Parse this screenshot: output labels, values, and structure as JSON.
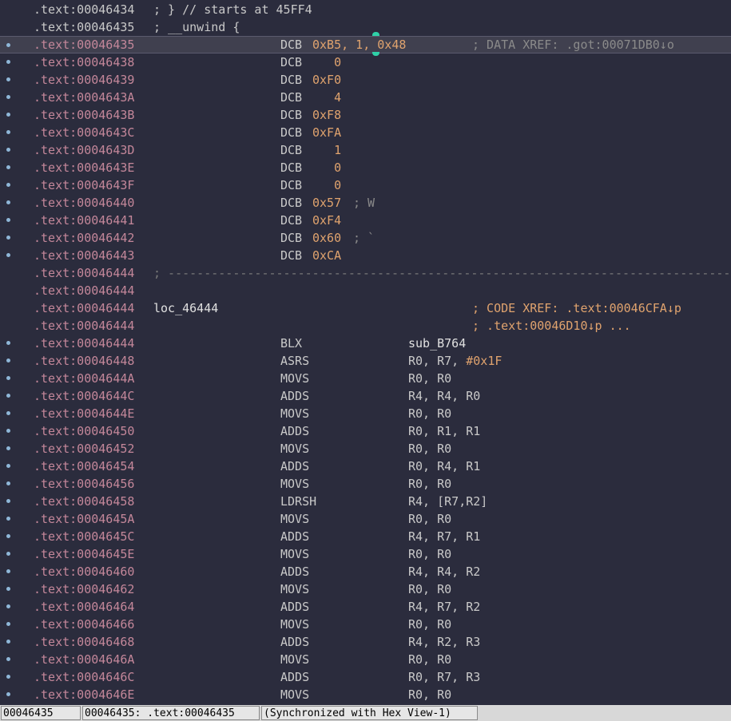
{
  "header_lines": [
    {
      "addr": ".text:00046434",
      "text": "; } // starts at 45FF4"
    },
    {
      "addr": ".text:00046435",
      "text": "; __unwind {"
    }
  ],
  "selected_line": {
    "addr": ".text:00046435",
    "mnemonic": "DCB",
    "value": "0xB5, 1, 0x48",
    "comment": "; DATA XREF: .got:00071DB0↓o"
  },
  "data_lines": [
    {
      "addr": ".text:00046438",
      "mnemonic": "DCB",
      "value": "   0",
      "comment": ""
    },
    {
      "addr": ".text:00046439",
      "mnemonic": "DCB",
      "value": "0xF0",
      "comment": ""
    },
    {
      "addr": ".text:0004643A",
      "mnemonic": "DCB",
      "value": "   4",
      "comment": ""
    },
    {
      "addr": ".text:0004643B",
      "mnemonic": "DCB",
      "value": "0xF8",
      "comment": ""
    },
    {
      "addr": ".text:0004643C",
      "mnemonic": "DCB",
      "value": "0xFA",
      "comment": ""
    },
    {
      "addr": ".text:0004643D",
      "mnemonic": "DCB",
      "value": "   1",
      "comment": ""
    },
    {
      "addr": ".text:0004643E",
      "mnemonic": "DCB",
      "value": "   0",
      "comment": ""
    },
    {
      "addr": ".text:0004643F",
      "mnemonic": "DCB",
      "value": "   0",
      "comment": ""
    },
    {
      "addr": ".text:00046440",
      "mnemonic": "DCB",
      "value": "0x57",
      "comment": "; W"
    },
    {
      "addr": ".text:00046441",
      "mnemonic": "DCB",
      "value": "0xF4",
      "comment": ""
    },
    {
      "addr": ".text:00046442",
      "mnemonic": "DCB",
      "value": "0x60",
      "comment": "; `"
    },
    {
      "addr": ".text:00046443",
      "mnemonic": "DCB",
      "value": "0xCA",
      "comment": ""
    }
  ],
  "separator_line": {
    "addr": ".text:00046444",
    "text": "; ---------------------------------------------------------------------------------------------"
  },
  "empty_line": {
    "addr": ".text:00046444"
  },
  "label_line": {
    "addr": ".text:00046444",
    "label": "loc_46444",
    "xref": "; CODE XREF: .text:00046CFA↓p"
  },
  "xref_cont_line": {
    "addr": ".text:00046444",
    "xref": "; .text:00046D10↓p ..."
  },
  "code_lines": [
    {
      "addr": ".text:00046444",
      "mnemonic": "BLX",
      "operands": "sub_B764"
    },
    {
      "addr": ".text:00046448",
      "mnemonic": "ASRS",
      "operands": "R0, R7, #0x1F"
    },
    {
      "addr": ".text:0004644A",
      "mnemonic": "MOVS",
      "operands": "R0, R0"
    },
    {
      "addr": ".text:0004644C",
      "mnemonic": "ADDS",
      "operands": "R4, R4, R0"
    },
    {
      "addr": ".text:0004644E",
      "mnemonic": "MOVS",
      "operands": "R0, R0"
    },
    {
      "addr": ".text:00046450",
      "mnemonic": "ADDS",
      "operands": "R0, R1, R1"
    },
    {
      "addr": ".text:00046452",
      "mnemonic": "MOVS",
      "operands": "R0, R0"
    },
    {
      "addr": ".text:00046454",
      "mnemonic": "ADDS",
      "operands": "R0, R4, R1"
    },
    {
      "addr": ".text:00046456",
      "mnemonic": "MOVS",
      "operands": "R0, R0"
    },
    {
      "addr": ".text:00046458",
      "mnemonic": "LDRSH",
      "operands": "R4, [R7,R2]"
    },
    {
      "addr": ".text:0004645A",
      "mnemonic": "MOVS",
      "operands": "R0, R0"
    },
    {
      "addr": ".text:0004645C",
      "mnemonic": "ADDS",
      "operands": "R4, R7, R1"
    },
    {
      "addr": ".text:0004645E",
      "mnemonic": "MOVS",
      "operands": "R0, R0"
    },
    {
      "addr": ".text:00046460",
      "mnemonic": "ADDS",
      "operands": "R4, R4, R2"
    },
    {
      "addr": ".text:00046462",
      "mnemonic": "MOVS",
      "operands": "R0, R0"
    },
    {
      "addr": ".text:00046464",
      "mnemonic": "ADDS",
      "operands": "R4, R7, R2"
    },
    {
      "addr": ".text:00046466",
      "mnemonic": "MOVS",
      "operands": "R0, R0"
    },
    {
      "addr": ".text:00046468",
      "mnemonic": "ADDS",
      "operands": "R4, R2, R3"
    },
    {
      "addr": ".text:0004646A",
      "mnemonic": "MOVS",
      "operands": "R0, R0"
    },
    {
      "addr": ".text:0004646C",
      "mnemonic": "ADDS",
      "operands": "R0, R7, R3"
    },
    {
      "addr": ".text:0004646E",
      "mnemonic": "MOVS",
      "operands": "R0, R0"
    }
  ],
  "statusbar": {
    "offset": "00046435",
    "location": "00046435: .text:00046435",
    "sync": "(Synchronized with Hex View-1)"
  },
  "colors": {
    "background": "#2b2c3d",
    "address": "#c4879a",
    "number": "#e0a36e",
    "comment": "#8a8a8a",
    "marker": "#2fd1a8"
  }
}
